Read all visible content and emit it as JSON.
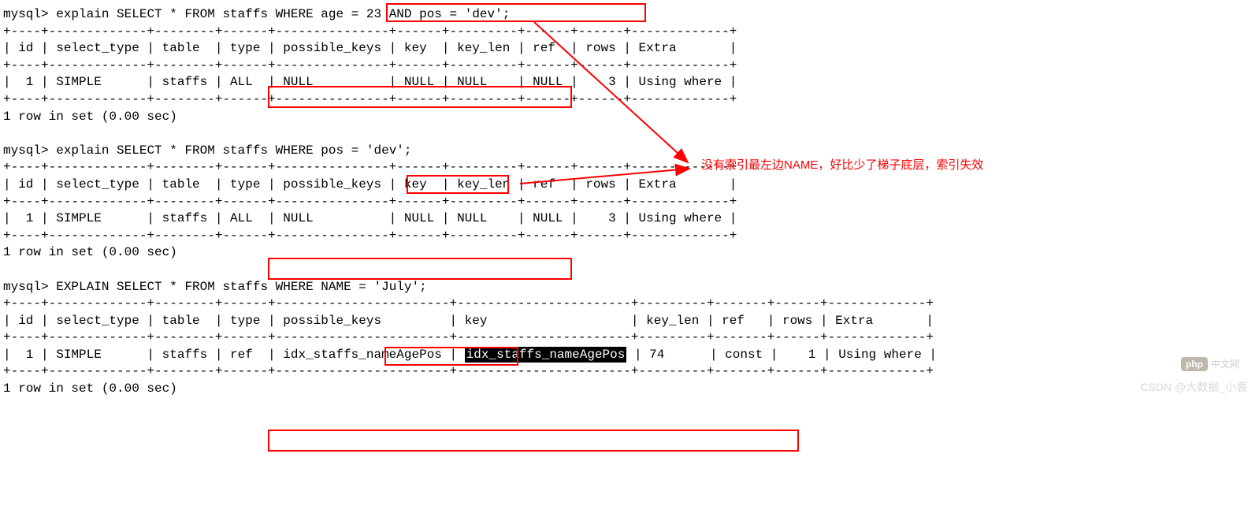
{
  "query1": {
    "prompt": "mysql> ",
    "cmd_prefix": "explain SELECT * FROM staffs WHERE ",
    "boxed": "age = 23 AND pos = 'dev'",
    "cmd_suffix": ";",
    "header": "| id | select_type | table  | type | possible_keys | key  | key_len | ref  | rows | Extra       |",
    "border": "+----+-------------+--------+------+---------------+------+---------+------+------+-------------+",
    "row_p1": "|  1 | SIMPLE      | staffs | ",
    "row_boxed": "ALL  | NULL          | NULL",
    "row_p2": " | NULL    | NULL |    3 | Using where |",
    "footer": "1 row in set (0.00 sec)"
  },
  "query2": {
    "prompt": "mysql> ",
    "cmd_prefix": "explain SELECT * FROM staffs WHERE ",
    "boxed": "pos = 'dev'",
    "cmd_suffix": ";",
    "header": "| id | select_type | table  | type | possible_keys | key  | key_len | ref  | rows | Extra       |",
    "border": "+----+-------------+--------+------+---------------+------+---------+------+------+-------------+",
    "row_p1": "|  1 | SIMPLE      | staffs | ",
    "row_boxed": "ALL  | NULL          | NULL",
    "row_p2": " | NULL    | NULL |    3 | Using where |",
    "footer": "1 row in set (0.00 sec)"
  },
  "query3": {
    "prompt": "mysql> ",
    "cmd_prefix": "EXPLAIN SELECT * FROM staffs WHERE ",
    "boxed": "NAME = 'July'",
    "cmd_suffix": ";",
    "header": "| id | select_type | table  | type | possible_keys         | key                   | key_len | ref   | rows | Extra       |",
    "border": "+----+-------------+--------+------+-----------------------+-----------------------+---------+-------+------+-------------+",
    "row_p1": "|  1 | SIMPLE      | staffs | ",
    "row_boxed_p1": "ref  | idx_staffs_nameAgePos | ",
    "row_hl": "idx_staffs_nameAgePos",
    "row_p2": " | 74      | const |    1 | Using where |",
    "footer": "1 row in set (0.00 sec)"
  },
  "annotation": "没有索引最左边NAME，好比少了梯子底层，索引失效",
  "watermark_php_text": "中文网",
  "watermark_php_badge": "php",
  "watermark_csdn": "CSDN @大数据_小袁"
}
